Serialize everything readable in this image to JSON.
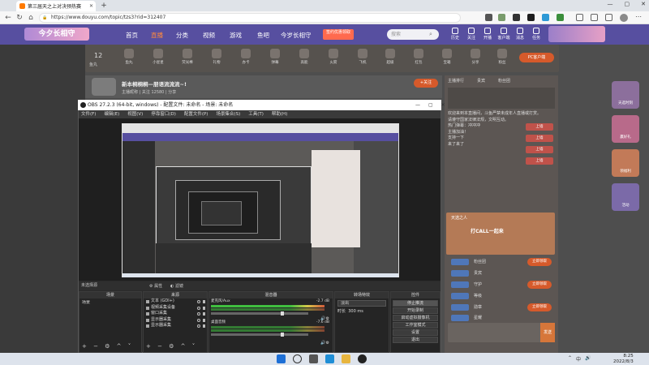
{
  "browser": {
    "tab_title": "第三届天之上对决预热赛",
    "new_tab": "+",
    "url": "https://www.douyu.com/topic/tzs3?rid=312407",
    "window_controls": [
      "—",
      "▢",
      "✕"
    ],
    "menu": "⋯"
  },
  "site": {
    "logo": "今夕长相守",
    "nav": [
      "首页",
      "直播",
      "分类",
      "视频",
      "游戏",
      "鱼吧",
      "今岁长相守"
    ],
    "active_nav": "直播",
    "promo": "签约优惠领取",
    "search_placeholder": "搜索",
    "header_icons": [
      "历史",
      "关注",
      "开播",
      "客户端",
      "消息",
      "任务"
    ],
    "gift_count": "12",
    "gift_count_label": "鱼丸",
    "gifts": [
      "鱼丸",
      "小星星",
      "荧光棒",
      "礼物",
      "办卡",
      "弹幕",
      "高能",
      "火箭",
      "飞机",
      "超级",
      "红包",
      "宝箱",
      "分享",
      "粉丝"
    ],
    "pc_button": "PC客户端",
    "streamer_title": "新本桐桐桐—朋语流流流~!",
    "streamer_sub": "主播昵称  |  关注 12580  |  分享",
    "follow_button": "+关注",
    "right_tabs": [
      "主播排行",
      "贵宾",
      "粉丝团"
    ],
    "chat_lines": [
      "欢迎来到本直播间，斗鱼严禁未成年人直播或打赏。",
      "请遵守国家法律法规，文明互动。",
      "热门弹幕：冲冲冲",
      "主播加油！",
      "支持一下",
      "来了来了"
    ],
    "chat_badges": [
      "上墙",
      "上墙",
      "上墙",
      "上墙"
    ],
    "promo_card_title": "天选之人",
    "promo_card_body": "打CALL一起来",
    "right_rows": [
      "粉丝团",
      "贵宾",
      "守护",
      "等级",
      "勋章",
      "星耀"
    ],
    "right_row_button": "立即领取",
    "send_button": "发送",
    "right_ads": [
      "天选时刻",
      "赢好礼",
      "领福利",
      "活动"
    ]
  },
  "obs": {
    "title": "OBS 27.2.3 (64-bit, windows) - 配置文件: 未命名 - 场景: 未命名",
    "window_controls": [
      "—",
      "▢",
      "✕"
    ],
    "menu": [
      "文件(F)",
      "编辑(E)",
      "视图(V)",
      "停靠窗口(D)",
      "配置文件(P)",
      "场景集合(S)",
      "工具(T)",
      "帮助(H)"
    ],
    "no_source": "未选择源",
    "properties": "属性",
    "filters": "滤镜",
    "scenes_header": "场景",
    "scenes": [
      "场景"
    ],
    "sources_header": "来源",
    "sources": [
      "文本 (GDI+)",
      "视频采集设备",
      "窗口采集",
      "显示器采集",
      "显示器采集"
    ],
    "mixer_header": "混音器",
    "mixer": [
      {
        "name": "麦克风/Aux",
        "db": "-2.7 dB"
      },
      {
        "name": "桌面音频",
        "db": "-7.6 dB"
      }
    ],
    "transitions_header": "转场特效",
    "transition": "淡出",
    "duration_label": "时长",
    "duration": "300 ms",
    "controls_header": "控件",
    "controls": [
      "停止推流",
      "开始录制",
      "启动虚拟摄像机",
      "工作室模式",
      "设置",
      "退出"
    ],
    "dock_footer": "+  −  ⚙  ^  ˅"
  },
  "taskbar": {
    "time": "8:25",
    "date": "2022/8/3",
    "tray": [
      "⌃",
      "中",
      "🔊"
    ]
  },
  "colors": {
    "site_header": "#574fa0",
    "accent_orange": "#d65a2b",
    "obs_bg": "#2b2b2b",
    "taskbar": "#dde3ec"
  }
}
